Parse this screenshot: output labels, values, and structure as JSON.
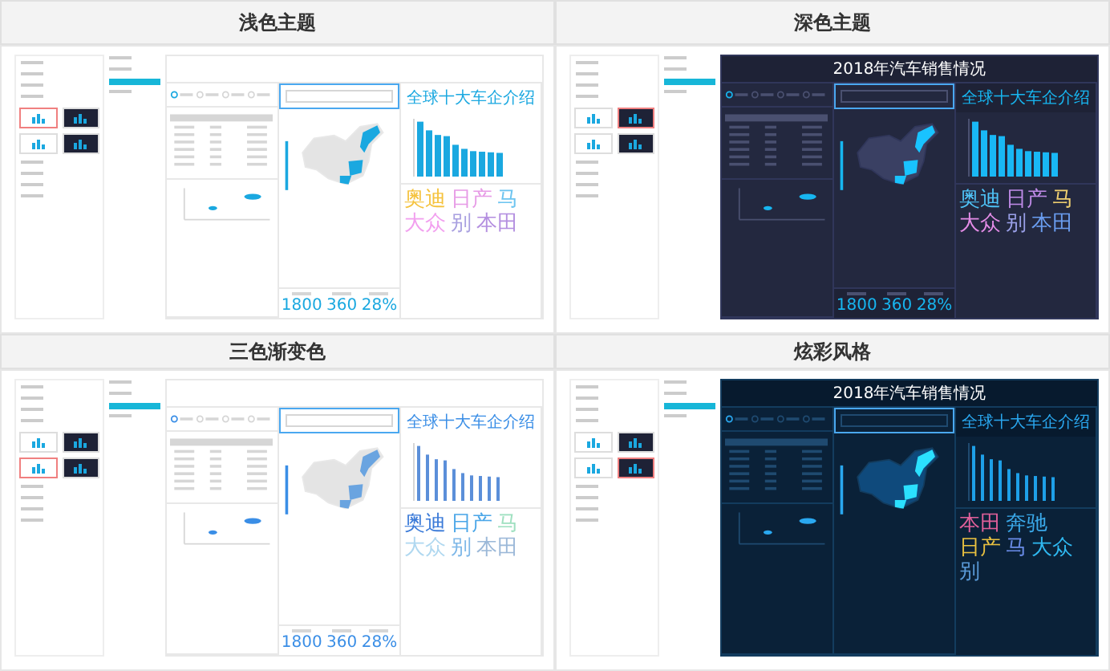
{
  "panels": [
    {
      "title": "浅色主题",
      "kind": "light",
      "swatches": [
        {
          "kind": "light",
          "selected": true
        },
        {
          "kind": "dark",
          "selected": false
        },
        {
          "kind": "light",
          "selected": false
        },
        {
          "kind": "dark",
          "selected": false
        }
      ],
      "link": "全球十大车企介绍",
      "kpis": [
        "1800",
        "360",
        "28%"
      ],
      "words": [
        {
          "text": "奥迪",
          "color": "#f5c23c"
        },
        {
          "text": "日产",
          "color": "#e79be6"
        },
        {
          "text": "马",
          "color": "#6cc4f0"
        },
        {
          "text": "大众",
          "color": "#f2a0ef"
        },
        {
          "text": "别",
          "color": "#a9a0e0"
        },
        {
          "text": "本田",
          "color": "#b48fe0"
        }
      ]
    },
    {
      "title": "深色主题",
      "kind": "dark",
      "dashboard_title": "2018年汽车销售情况",
      "swatches": [
        {
          "kind": "light",
          "selected": false
        },
        {
          "kind": "dark",
          "selected": true
        },
        {
          "kind": "light",
          "selected": false
        },
        {
          "kind": "dark",
          "selected": false
        }
      ],
      "link": "全球十大车企介绍",
      "kpis": [
        "1800",
        "360",
        "28%"
      ],
      "words": [
        {
          "text": "奥迪",
          "color": "#4fc3f7"
        },
        {
          "text": "日产",
          "color": "#c08be8"
        },
        {
          "text": "马",
          "color": "#f0d070"
        },
        {
          "text": "大众",
          "color": "#e38ce6"
        },
        {
          "text": "别",
          "color": "#9aa0e8"
        },
        {
          "text": "本田",
          "color": "#6a9df0"
        }
      ]
    },
    {
      "title": "三色渐变色",
      "kind": "gradient",
      "swatches": [
        {
          "kind": "light",
          "selected": false
        },
        {
          "kind": "dark",
          "selected": false
        },
        {
          "kind": "light",
          "selected": true
        },
        {
          "kind": "dark",
          "selected": false
        }
      ],
      "link": "全球十大车企介绍",
      "kpis": [
        "1800",
        "360",
        "28%"
      ],
      "words": [
        {
          "text": "奥迪",
          "color": "#3a7ad8"
        },
        {
          "text": "日产",
          "color": "#4aa6e8"
        },
        {
          "text": "马",
          "color": "#9fe0c0"
        },
        {
          "text": "大众",
          "color": "#b0d8f0"
        },
        {
          "text": "别",
          "color": "#7fb8e8"
        },
        {
          "text": "本田",
          "color": "#9bb8d8"
        }
      ]
    },
    {
      "title": "炫彩风格",
      "kind": "neon",
      "dashboard_title": "2018年汽车销售情况",
      "swatches": [
        {
          "kind": "light",
          "selected": false
        },
        {
          "kind": "dark",
          "selected": false
        },
        {
          "kind": "light",
          "selected": false
        },
        {
          "kind": "dark",
          "selected": true
        }
      ],
      "link": "全球十大车企介绍",
      "words": [
        {
          "text": "本田",
          "color": "#e0609a"
        },
        {
          "text": "奔驰",
          "color": "#3aa8e8"
        },
        {
          "text": "日产",
          "color": "#e8c040"
        },
        {
          "text": "马",
          "color": "#6a8ce8"
        },
        {
          "text": "大众",
          "color": "#2fb8f0"
        },
        {
          "text": "别",
          "color": "#5a9ad8"
        }
      ]
    }
  ]
}
